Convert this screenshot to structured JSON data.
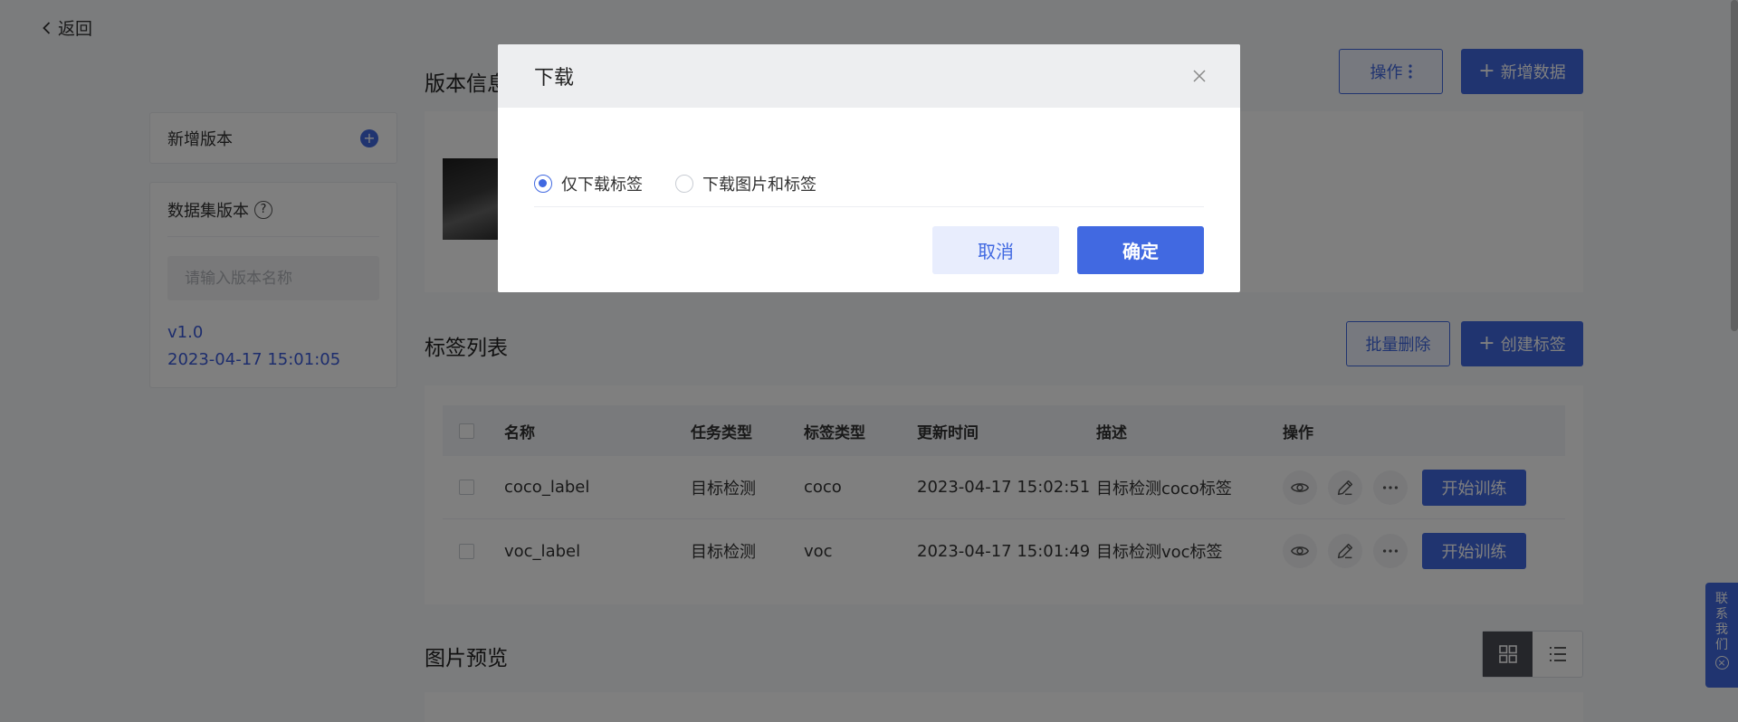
{
  "back_label": "返回",
  "sidebar": {
    "add_version_label": "新增版本",
    "version_title": "数据集版本",
    "version_input_placeholder": "请输入版本名称",
    "version_name": "v1.0",
    "version_time": "2023-04-17 15:01:05"
  },
  "version_info": {
    "title": "版本信息"
  },
  "actions": {
    "operate_label": "操作",
    "add_data_label": "新增数据"
  },
  "label_list": {
    "title": "标签列表",
    "batch_delete_label": "批量删除",
    "create_label": "创建标签",
    "columns": [
      "名称",
      "任务类型",
      "标签类型",
      "更新时间",
      "描述",
      "操作"
    ],
    "rows": [
      {
        "name": "coco_label",
        "task": "目标检测",
        "type": "coco",
        "time": "2023-04-17 15:02:51",
        "desc": "目标检测coco标签",
        "train": "开始训练"
      },
      {
        "name": "voc_label",
        "task": "目标检测",
        "type": "voc",
        "time": "2023-04-17 15:01:49",
        "desc": "目标检测voc标签",
        "train": "开始训练"
      }
    ]
  },
  "image_preview": {
    "title": "图片预览"
  },
  "contact": {
    "chars": [
      "联",
      "系",
      "我",
      "们"
    ]
  },
  "modal": {
    "title": "下载",
    "options": [
      "仅下载标签",
      "下载图片和标签"
    ],
    "selected_index": 0,
    "cancel_label": "取消",
    "confirm_label": "确定"
  },
  "colors": {
    "primary": "#4169e1",
    "overlay": "rgba(0,0,0,0.5)"
  }
}
